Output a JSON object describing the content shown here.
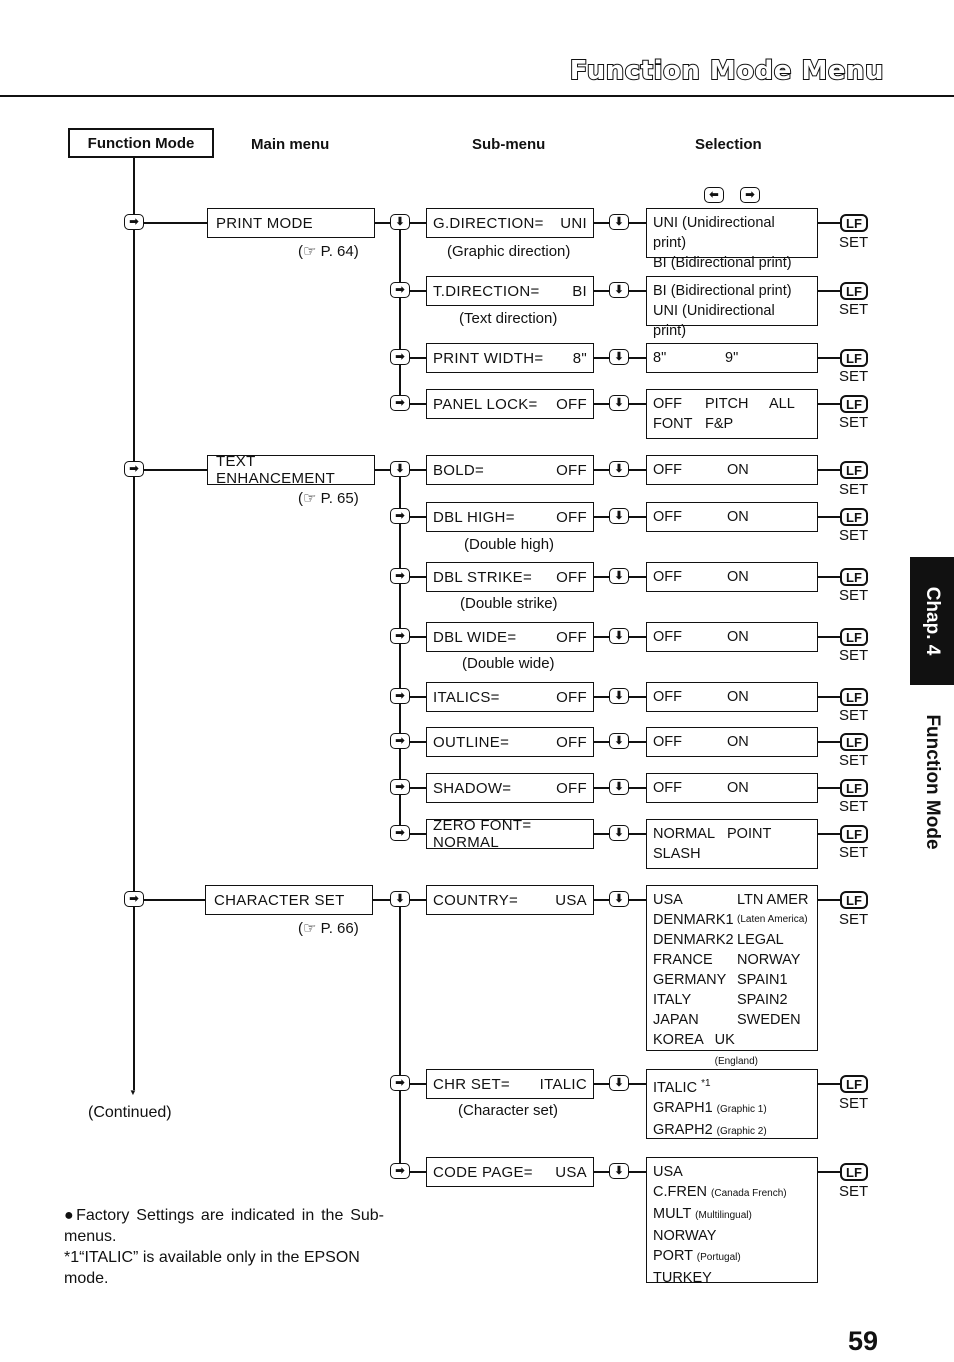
{
  "page": {
    "title": "Function Mode Menu",
    "page_number": "59",
    "chapter_tab": "Chap. 4",
    "chapter_title": "Function Mode"
  },
  "headers": {
    "function_mode": "Function Mode",
    "main_menu": "Main menu",
    "sub_menu": "Sub-menu",
    "selection": "Selection"
  },
  "icons": {
    "right_key": "➡",
    "left_key": "⬅",
    "down_key": "⬇",
    "lf_key": "LF",
    "set_label": "SET",
    "hand_icon": "☞"
  },
  "main_menus": [
    {
      "label": "PRINT MODE",
      "ref": "P. 64"
    },
    {
      "label": "TEXT ENHANCEMENT",
      "ref": "P. 65"
    },
    {
      "label": "CHARACTER SET",
      "ref": "P. 66"
    }
  ],
  "sub_menus": [
    {
      "name": "G.DIRECTION=",
      "value": "UNI",
      "caption": "(Graphic direction)",
      "options": [
        "UNI (Unidirectional print)",
        "BI (Bidirectional print)"
      ]
    },
    {
      "name": "T.DIRECTION=",
      "value": "BI",
      "caption": "(Text direction)",
      "options": [
        "BI (Bidirectional print)",
        "UNI (Unidirectional print)"
      ]
    },
    {
      "name": "PRINT WIDTH=",
      "value": "8\"",
      "caption": "",
      "options": [
        "8\"",
        "9\""
      ]
    },
    {
      "name": "PANEL LOCK=",
      "value": "OFF",
      "caption": "",
      "options": [
        "OFF",
        "PITCH",
        "ALL",
        "FONT",
        "F&P"
      ]
    },
    {
      "name": "BOLD=",
      "value": "OFF",
      "caption": "",
      "options": [
        "OFF",
        "ON"
      ]
    },
    {
      "name": "DBL HIGH=",
      "value": "OFF",
      "caption": "(Double high)",
      "options": [
        "OFF",
        "ON"
      ]
    },
    {
      "name": "DBL STRIKE=",
      "value": "OFF",
      "caption": "(Double strike)",
      "options": [
        "OFF",
        "ON"
      ]
    },
    {
      "name": "DBL WIDE=",
      "value": "OFF",
      "caption": "(Double wide)",
      "options": [
        "OFF",
        "ON"
      ]
    },
    {
      "name": "ITALICS=",
      "value": "OFF",
      "caption": "",
      "options": [
        "OFF",
        "ON"
      ]
    },
    {
      "name": "OUTLINE=",
      "value": "OFF",
      "caption": "",
      "options": [
        "OFF",
        "ON"
      ]
    },
    {
      "name": "SHADOW=",
      "value": "OFF",
      "caption": "",
      "options": [
        "OFF",
        "ON"
      ]
    },
    {
      "name": "ZERO FONT=",
      "value": "NORMAL",
      "caption": "",
      "options": [
        "NORMAL",
        "POINT",
        "SLASH"
      ]
    },
    {
      "name": "COUNTRY=",
      "value": "USA",
      "caption": "",
      "options": [
        [
          "USA",
          "LTN AMER"
        ],
        [
          "DENMARK1",
          "(Laten America)"
        ],
        [
          "DENMARK2",
          "LEGAL"
        ],
        [
          "FRANCE",
          "NORWAY"
        ],
        [
          "GERMANY",
          "SPAIN1"
        ],
        [
          "ITALY",
          "SPAIN2"
        ],
        [
          "JAPAN",
          "SWEDEN"
        ],
        [
          "KOREA",
          "UK",
          "(England)"
        ]
      ]
    },
    {
      "name": "CHR SET=",
      "value": "ITALIC",
      "caption": "(Character set)",
      "options": [
        [
          "ITALIC",
          "*1",
          ""
        ],
        [
          "GRAPH1",
          "",
          "(Graphic 1)"
        ],
        [
          "GRAPH2",
          "",
          "(Graphic 2)"
        ]
      ]
    },
    {
      "name": "CODE PAGE=",
      "value": "USA",
      "caption": "",
      "options": [
        [
          "USA",
          ""
        ],
        [
          "C.FREN",
          "(Canada French)"
        ],
        [
          "MULT",
          "(Multilingual)"
        ],
        [
          "NORWAY",
          ""
        ],
        [
          "PORT",
          "(Portugal)"
        ],
        [
          "TURKEY",
          ""
        ]
      ]
    }
  ],
  "continued": "(Continued)",
  "notes": {
    "factory": "●Factory Settings are indicated in the Sub-menus.",
    "footnote": "*1“ITALIC” is available only in the EPSON mode."
  }
}
